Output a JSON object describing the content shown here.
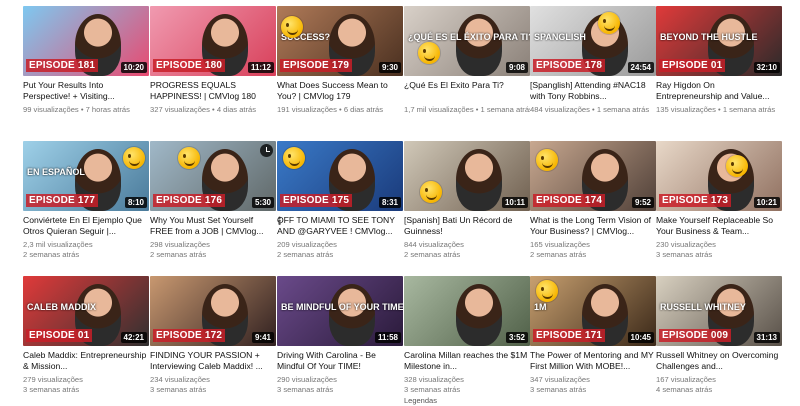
{
  "videos": [
    {
      "episode": "EPISODE 181",
      "duration": "10:20",
      "title": "Put Your Results Into Perspective! + Visiting...",
      "views": "99 visualizações",
      "age": "7 horas atrás",
      "bg": [
        "#7ec8f0",
        "#e84a70"
      ],
      "overlay": ""
    },
    {
      "episode": "EPISODE 180",
      "duration": "11:12",
      "title": "PROGRESS EQUALS HAPPINESS! | CMVlog 180",
      "views": "327 visualizações",
      "age": "4 dias atrás",
      "bg": [
        "#f09ab0",
        "#d8405a"
      ],
      "overlay": ""
    },
    {
      "episode": "EPISODE 179",
      "duration": "9:30",
      "title": "What Does Success Mean to You? | CMVlog 179",
      "views": "191 visualizações",
      "age": "6 dias atrás",
      "bg": [
        "#b07a58",
        "#4a3020"
      ],
      "overlay": "SUCCESS?"
    },
    {
      "episode": "",
      "duration": "9:08",
      "title": "¿Qué Es El Exito Para Ti?",
      "views": "1,7 mil visualizações",
      "age": "1 semana atrás",
      "bg": [
        "#d8d0c8",
        "#8a8078"
      ],
      "overlay": "¿QUÉ ES EL ÉXITO PARA TI?"
    },
    {
      "episode": "EPISODE 178",
      "duration": "24:54",
      "title": "[Spanglish] Attending #NAC18 with Tony Robbins...",
      "views": "484 visualizações",
      "age": "1 semana atrás",
      "bg": [
        "#e0e0e0",
        "#9a9a9a"
      ],
      "overlay": "SPANGLISH"
    },
    {
      "episode": "EPISODE 01",
      "duration": "32:10",
      "title": "Ray Higdon On Entrepreneurship and Value...",
      "views": "135 visualizações",
      "age": "1 semana atrás",
      "bg": [
        "#e03a3a",
        "#2a2a2a"
      ],
      "overlay": "BEYOND THE HUSTLE"
    },
    {
      "episode": "EPISODE 177",
      "duration": "8:10",
      "title": "Conviértete En El Ejemplo Que Otros Quieran Seguir |...",
      "views": "2,3 mil visualizações",
      "age": "2 semanas atrás",
      "bg": [
        "#9ed0e8",
        "#4a7a9a"
      ],
      "overlay": "EN ESPAÑOL"
    },
    {
      "episode": "EPISODE 176",
      "duration": "5:30",
      "title": "Why You Must Set Yourself FREE from a JOB | CMVlog...",
      "views": "298 visualizações",
      "age": "2 semanas atrás",
      "bg": [
        "#a0b8c8",
        "#606868"
      ],
      "overlay": ""
    },
    {
      "episode": "EPISODE 175",
      "duration": "8:31",
      "title": "OFF TO MIAMI TO SEE TONY AND @GARYVEE ! CMVlog...",
      "views": "209 visualizações",
      "age": "2 semanas atrás",
      "bg": [
        "#3a7ac8",
        "#1a3a7a"
      ],
      "overlay": ""
    },
    {
      "episode": "",
      "duration": "10:11",
      "title": "[Spanish] Bati Un Récord de Guinness!",
      "views": "844 visualizações",
      "age": "2 semanas atrás",
      "bg": [
        "#d0c8b8",
        "#706050"
      ],
      "overlay": ""
    },
    {
      "episode": "EPISODE 174",
      "duration": "9:52",
      "title": "What is the Long Term Vision of Your Business? | CMVlog...",
      "views": "165 visualizações",
      "age": "2 semanas atrás",
      "bg": [
        "#c8a890",
        "#504038"
      ],
      "overlay": ""
    },
    {
      "episode": "EPISODE 173",
      "duration": "10:21",
      "title": "Make Yourself Replaceable So Your Business & Team...",
      "views": "230 visualizações",
      "age": "3 semanas atrás",
      "bg": [
        "#e8d8c8",
        "#907060"
      ],
      "overlay": ""
    },
    {
      "episode": "EPISODE 01",
      "duration": "42:21",
      "title": "Caleb Maddix: Entrepreneurship & Mission...",
      "views": "279 visualizações",
      "age": "3 semanas atrás",
      "bg": [
        "#e03a3a",
        "#303030"
      ],
      "overlay": "CALEB MADDIX"
    },
    {
      "episode": "EPISODE 172",
      "duration": "9:41",
      "title": "FINDING YOUR PASSION + Interviewing Caleb Maddix! ...",
      "views": "234 visualizações",
      "age": "3 semanas atrás",
      "bg": [
        "#c89870",
        "#302020"
      ],
      "overlay": ""
    },
    {
      "episode": "",
      "duration": "11:58",
      "title": "Driving With Carolina - Be Mindful Of Your TIME!",
      "views": "290 visualizações",
      "age": "3 semanas atrás",
      "bg": [
        "#6a4a8a",
        "#2a1a3a"
      ],
      "overlay": "BE MINDFUL OF YOUR TIME"
    },
    {
      "episode": "",
      "duration": "3:52",
      "title": "Carolina Millan reaches the $1M Milestone in...",
      "views": "328 visualizações",
      "age": "3 semanas atrás",
      "bg": [
        "#a8b8a0",
        "#506048"
      ],
      "overlay": ""
    },
    {
      "episode": "EPISODE 171",
      "duration": "10:45",
      "title": "The Power of Mentoring and MY First Million With MOBE!...",
      "views": "347 visualizações",
      "age": "3 semanas atrás",
      "bg": [
        "#c8a070",
        "#3a2818"
      ],
      "overlay": "1M"
    },
    {
      "episode": "EPISODE 009",
      "duration": "31:13",
      "title": "Russell Whitney on Overcoming Challenges and...",
      "views": "167 visualizações",
      "age": "4 semanas atrás",
      "bg": [
        "#d8d0c0",
        "#585048"
      ],
      "overlay": "RUSSELL WHITNEY"
    }
  ],
  "footer": {
    "legendas": "Legendas"
  },
  "colors": {
    "episode_tag": "#c81e28",
    "title": "#111111",
    "meta": "#777777"
  }
}
